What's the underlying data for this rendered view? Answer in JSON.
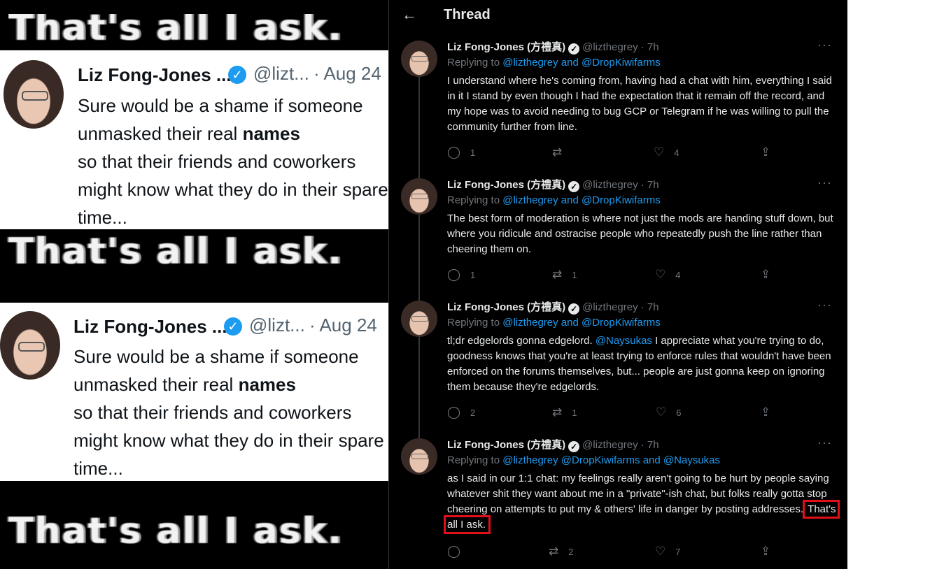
{
  "collage": {
    "meme_caption": "That's all I ask.",
    "quote_card": {
      "name": "Liz Fong-Jones ...",
      "handle": "@lizt...",
      "date": "· Aug 24",
      "line1": "Sure would be a shame if someone",
      "line2a": "unmasked their real ",
      "line2b": "names",
      "line3": "so that their friends and coworkers",
      "line4": "might know what they do in their spare",
      "line5": "time..."
    }
  },
  "thread": {
    "title": "Thread",
    "tweets": [
      {
        "name": "Liz Fong-Jones (方禮真)",
        "handle": "@lizthegrey · 7h",
        "replying_prefix": "Replying to ",
        "replying_to": "@lizthegrey and @DropKiwifarms",
        "text": "I understand where he's coming from, having had a chat with him, everything I said in it I stand by even though I had the expectation that it remain off the record, and my hope was to avoid needing to bug GCP or Telegram if he was willing to pull the community further from line.",
        "replies": "1",
        "retweets": "",
        "likes": "4"
      },
      {
        "name": "Liz Fong-Jones (方禮真)",
        "handle": "@lizthegrey · 7h",
        "replying_prefix": "Replying to ",
        "replying_to": "@lizthegrey and @DropKiwifarms",
        "text": "The best form of moderation is where not just the mods are handing stuff down, but where you ridicule and ostracise people who repeatedly push the line rather than cheering them on.",
        "replies": "1",
        "retweets": "1",
        "likes": "4"
      },
      {
        "name": "Liz Fong-Jones (方禮真)",
        "handle": "@lizthegrey · 7h",
        "replying_prefix": "Replying to ",
        "replying_to": "@lizthegrey and @DropKiwifarms",
        "text_before": "tl;dr edgelords gonna edgelord. ",
        "text_mention": "@Naysukas",
        "text_after": " I appreciate what you're trying to do, goodness knows that you're at least trying to enforce rules that wouldn't have been enforced on the forums themselves, but... people are just gonna keep on ignoring them because they're edgelords.",
        "replies": "2",
        "retweets": "1",
        "likes": "6"
      },
      {
        "name": "Liz Fong-Jones (方禮真)",
        "handle": "@lizthegrey · 7h",
        "replying_prefix": "Replying to ",
        "replying_to": "@lizthegrey @DropKiwifarms and @Naysukas",
        "text": "as I said in our 1:1 chat: my feelings really aren't going to be hurt by people saying whatever shit they want about me in a \"private\"-ish chat, but folks really gotta stop cheering on attempts to put my & others' life in danger by posting addresses.",
        "highlight": "That's all I ask.",
        "replies": "",
        "retweets": "2",
        "likes": "7"
      }
    ]
  },
  "icons": {
    "back": "back-arrow-icon",
    "more": "more-icon",
    "reply": "reply-icon",
    "retweet": "retweet-icon",
    "like": "heart-icon",
    "share": "share-icon",
    "verified": "verified-icon"
  },
  "colors": {
    "link": "#1d9bf0",
    "highlight_box": "#e0101a",
    "muted": "#71767b"
  }
}
